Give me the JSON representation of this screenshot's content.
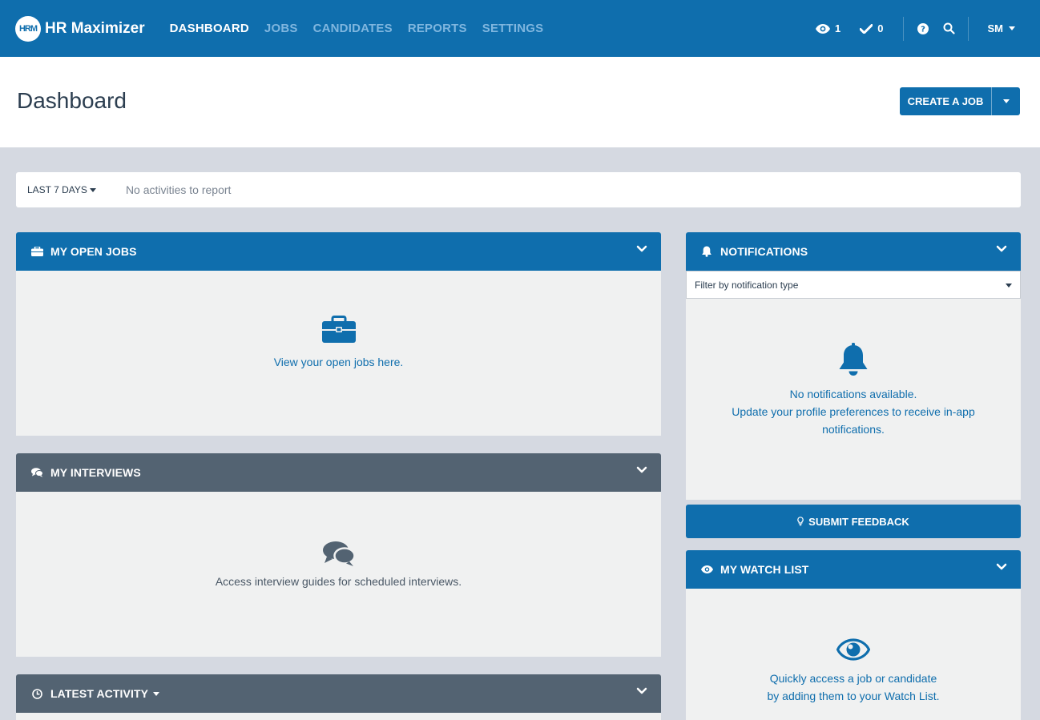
{
  "brand": {
    "logo_text": "HRM",
    "name": "HR Maximizer"
  },
  "nav": {
    "items": [
      {
        "label": "DASHBOARD",
        "active": true
      },
      {
        "label": "JOBS",
        "active": false
      },
      {
        "label": "CANDIDATES",
        "active": false
      },
      {
        "label": "REPORTS",
        "active": false
      },
      {
        "label": "SETTINGS",
        "active": false
      }
    ],
    "watch_count": "1",
    "tasks_count": "0",
    "user_initials": "SM"
  },
  "header": {
    "title": "Dashboard",
    "create_job_label": "CREATE A JOB"
  },
  "activity": {
    "range_label": "LAST 7 DAYS",
    "empty_text": "No activities to report"
  },
  "open_jobs": {
    "title": "MY OPEN JOBS",
    "empty_text": "View your open jobs here."
  },
  "interviews": {
    "title": "MY INTERVIEWS",
    "empty_text": "Access interview guides for scheduled interviews."
  },
  "latest_activity": {
    "title": "LATEST ACTIVITY"
  },
  "notifications": {
    "title": "NOTIFICATIONS",
    "filter_placeholder": "Filter by notification type",
    "empty_line1": "No notifications available.",
    "empty_line2": "Update your profile preferences to receive in-app",
    "empty_line3": "notifications."
  },
  "feedback": {
    "label": "SUBMIT FEEDBACK"
  },
  "watch_list": {
    "title": "MY WATCH LIST",
    "empty_line1": "Quickly access a job or candidate",
    "empty_line2": "by adding them to your Watch List."
  },
  "colors": {
    "primary": "#0f6ead",
    "slate": "#536372",
    "background": "#d5d9e1",
    "panel_body": "#f0f1f1"
  }
}
